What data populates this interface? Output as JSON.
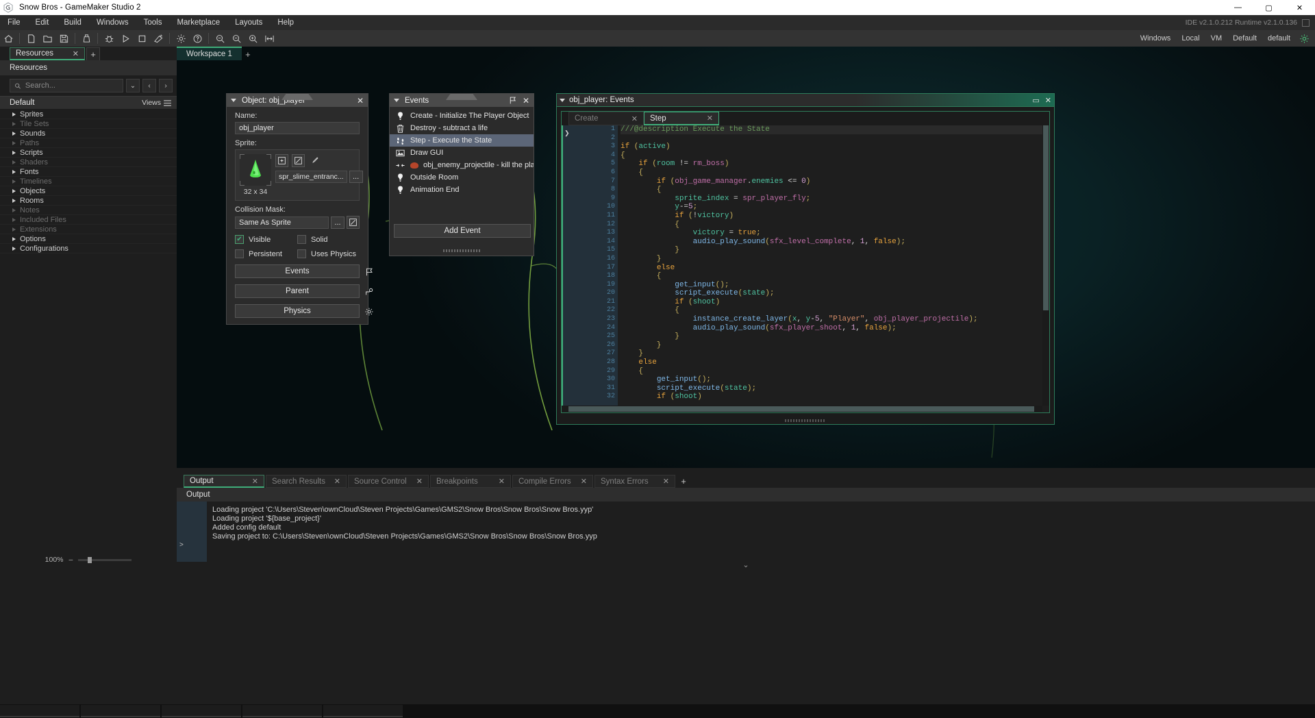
{
  "window": {
    "title": "Snow Bros - GameMaker Studio 2",
    "minimize": "—",
    "maximize": "▢",
    "close": "✕"
  },
  "menubar": {
    "items": [
      "File",
      "Edit",
      "Build",
      "Windows",
      "Tools",
      "Marketplace",
      "Layouts",
      "Help"
    ],
    "version_text": "IDE v2.1.0.212 Runtime v2.1.0.136"
  },
  "toolbar": {
    "right_items": [
      "Windows",
      "Local",
      "VM",
      "Default",
      "default"
    ]
  },
  "left_panel": {
    "tab_label": "Resources",
    "tab_close": "✕",
    "tab_add": "+",
    "header": "Resources",
    "search_placeholder": "Search...",
    "search_value": "",
    "default_label": "Default",
    "views_label": "Views",
    "tree": [
      {
        "label": "Sprites",
        "enabled": true
      },
      {
        "label": "Tile Sets",
        "enabled": false
      },
      {
        "label": "Sounds",
        "enabled": true
      },
      {
        "label": "Paths",
        "enabled": false
      },
      {
        "label": "Scripts",
        "enabled": true
      },
      {
        "label": "Shaders",
        "enabled": false
      },
      {
        "label": "Fonts",
        "enabled": true
      },
      {
        "label": "Timelines",
        "enabled": false
      },
      {
        "label": "Objects",
        "enabled": true
      },
      {
        "label": "Rooms",
        "enabled": true
      },
      {
        "label": "Notes",
        "enabled": false
      },
      {
        "label": "Included Files",
        "enabled": false
      },
      {
        "label": "Extensions",
        "enabled": false
      },
      {
        "label": "Options",
        "enabled": true
      },
      {
        "label": "Configurations",
        "enabled": true
      }
    ],
    "zoom_level": "100%"
  },
  "workspace": {
    "tab_label": "Workspace 1",
    "tab_add": "+"
  },
  "object_window": {
    "title": "Object: obj_player",
    "close": "✕",
    "name_label": "Name:",
    "name_value": "obj_player",
    "sprite_label": "Sprite:",
    "sprite_name": "spr_slime_entranc...",
    "sprite_dims": "32 x 34",
    "sprite_more": "...",
    "collision_label": "Collision Mask:",
    "collision_value": "Same As Sprite",
    "collision_more": "...",
    "checkboxes": [
      {
        "label": "Visible",
        "checked": true
      },
      {
        "label": "Solid",
        "checked": false
      },
      {
        "label": "Persistent",
        "checked": false
      },
      {
        "label": "Uses Physics",
        "checked": false
      }
    ],
    "buttons": [
      "Events",
      "Parent",
      "Physics"
    ]
  },
  "events_window": {
    "title": "Events",
    "close": "✕",
    "items": [
      {
        "label": "Create - Initialize The Player Object",
        "icon": "lightbulb-icon",
        "selected": false
      },
      {
        "label": "Destroy - subtract a life",
        "icon": "trash-icon",
        "selected": false
      },
      {
        "label": "Step - Execute the State",
        "icon": "footsteps-icon",
        "selected": true
      },
      {
        "label": "Draw GUI",
        "icon": "image-icon",
        "selected": false
      },
      {
        "label": "obj_enemy_projectile - kill the player",
        "icon": "collision-icon",
        "selected": false
      },
      {
        "label": "Outside Room",
        "icon": "lightbulb-icon",
        "selected": false
      },
      {
        "label": "Animation End",
        "icon": "lightbulb-icon",
        "selected": false
      }
    ],
    "add_event_label": "Add Event"
  },
  "code_window": {
    "title": "obj_player: Events",
    "minimize": "▭",
    "close": "✕",
    "tabs": [
      {
        "label": "Create",
        "active": false,
        "close": "✕"
      },
      {
        "label": "Step",
        "active": true,
        "close": "✕"
      }
    ],
    "lines": [
      {
        "n": 1,
        "tokens": [
          {
            "t": "///@description Execute the State",
            "c": "com"
          }
        ]
      },
      {
        "n": 2,
        "tokens": []
      },
      {
        "n": 3,
        "tokens": [
          {
            "t": "if",
            "c": "kw"
          },
          {
            "t": " (",
            "c": "brc"
          },
          {
            "t": "active",
            "c": "var"
          },
          {
            "t": ")",
            "c": "brc"
          }
        ]
      },
      {
        "n": 4,
        "tokens": [
          {
            "t": "{",
            "c": "brc"
          }
        ]
      },
      {
        "n": 5,
        "tokens": [
          {
            "t": "    ",
            "c": ""
          },
          {
            "t": "if",
            "c": "kw"
          },
          {
            "t": " (",
            "c": "brc"
          },
          {
            "t": "room",
            "c": "var"
          },
          {
            "t": " != ",
            "c": "op"
          },
          {
            "t": "rm_boss",
            "c": "res"
          },
          {
            "t": ")",
            "c": "brc"
          }
        ]
      },
      {
        "n": 6,
        "tokens": [
          {
            "t": "    {",
            "c": "brc"
          }
        ]
      },
      {
        "n": 7,
        "tokens": [
          {
            "t": "        ",
            "c": ""
          },
          {
            "t": "if",
            "c": "kw"
          },
          {
            "t": " (",
            "c": "brc"
          },
          {
            "t": "obj_game_manager",
            "c": "res"
          },
          {
            "t": ".",
            "c": "op"
          },
          {
            "t": "enemies",
            "c": "var"
          },
          {
            "t": " <= ",
            "c": "op"
          },
          {
            "t": "0",
            "c": "num"
          },
          {
            "t": ")",
            "c": "brc"
          }
        ]
      },
      {
        "n": 8,
        "tokens": [
          {
            "t": "        {",
            "c": "brc"
          }
        ]
      },
      {
        "n": 9,
        "tokens": [
          {
            "t": "            ",
            "c": ""
          },
          {
            "t": "sprite_index",
            "c": "var"
          },
          {
            "t": " = ",
            "c": "op"
          },
          {
            "t": "spr_player_fly",
            "c": "res"
          },
          {
            "t": ";",
            "c": "brc"
          }
        ]
      },
      {
        "n": 10,
        "tokens": [
          {
            "t": "            ",
            "c": ""
          },
          {
            "t": "y",
            "c": "var"
          },
          {
            "t": "-=",
            "c": "op"
          },
          {
            "t": "5",
            "c": "num"
          },
          {
            "t": ";",
            "c": "brc"
          }
        ]
      },
      {
        "n": 11,
        "tokens": [
          {
            "t": "            ",
            "c": ""
          },
          {
            "t": "if",
            "c": "kw"
          },
          {
            "t": " (",
            "c": "brc"
          },
          {
            "t": "!",
            "c": "op"
          },
          {
            "t": "victory",
            "c": "var"
          },
          {
            "t": ")",
            "c": "brc"
          }
        ]
      },
      {
        "n": 12,
        "tokens": [
          {
            "t": "            {",
            "c": "brc"
          }
        ]
      },
      {
        "n": 13,
        "tokens": [
          {
            "t": "                ",
            "c": ""
          },
          {
            "t": "victory",
            "c": "var"
          },
          {
            "t": " = ",
            "c": "op"
          },
          {
            "t": "true",
            "c": "kw"
          },
          {
            "t": ";",
            "c": "brc"
          }
        ]
      },
      {
        "n": 14,
        "tokens": [
          {
            "t": "                ",
            "c": ""
          },
          {
            "t": "audio_play_sound",
            "c": "fn"
          },
          {
            "t": "(",
            "c": "brc"
          },
          {
            "t": "sfx_level_complete",
            "c": "res"
          },
          {
            "t": ", ",
            "c": "op"
          },
          {
            "t": "1",
            "c": "num"
          },
          {
            "t": ", ",
            "c": "op"
          },
          {
            "t": "false",
            "c": "kw"
          },
          {
            "t": ");",
            "c": "brc"
          }
        ]
      },
      {
        "n": 15,
        "tokens": [
          {
            "t": "            }",
            "c": "brc"
          }
        ]
      },
      {
        "n": 16,
        "tokens": [
          {
            "t": "        }",
            "c": "brc"
          }
        ]
      },
      {
        "n": 17,
        "tokens": [
          {
            "t": "        ",
            "c": ""
          },
          {
            "t": "else",
            "c": "kw"
          }
        ]
      },
      {
        "n": 18,
        "tokens": [
          {
            "t": "        {",
            "c": "brc"
          }
        ]
      },
      {
        "n": 19,
        "tokens": [
          {
            "t": "            ",
            "c": ""
          },
          {
            "t": "get_input",
            "c": "fn"
          },
          {
            "t": "();",
            "c": "brc"
          }
        ]
      },
      {
        "n": 20,
        "tokens": [
          {
            "t": "            ",
            "c": ""
          },
          {
            "t": "script_execute",
            "c": "fn"
          },
          {
            "t": "(",
            "c": "brc"
          },
          {
            "t": "state",
            "c": "var"
          },
          {
            "t": ");",
            "c": "brc"
          }
        ]
      },
      {
        "n": 21,
        "tokens": [
          {
            "t": "            ",
            "c": ""
          },
          {
            "t": "if",
            "c": "kw"
          },
          {
            "t": " (",
            "c": "brc"
          },
          {
            "t": "shoot",
            "c": "var"
          },
          {
            "t": ")",
            "c": "brc"
          }
        ]
      },
      {
        "n": 22,
        "tokens": [
          {
            "t": "            {",
            "c": "brc"
          }
        ]
      },
      {
        "n": 23,
        "tokens": [
          {
            "t": "                ",
            "c": ""
          },
          {
            "t": "instance_create_layer",
            "c": "fn"
          },
          {
            "t": "(",
            "c": "brc"
          },
          {
            "t": "x",
            "c": "var"
          },
          {
            "t": ", ",
            "c": "op"
          },
          {
            "t": "y",
            "c": "var"
          },
          {
            "t": "-",
            "c": "op"
          },
          {
            "t": "5",
            "c": "num"
          },
          {
            "t": ", ",
            "c": "op"
          },
          {
            "t": "\"Player\"",
            "c": "str"
          },
          {
            "t": ", ",
            "c": "op"
          },
          {
            "t": "obj_player_projectile",
            "c": "res"
          },
          {
            "t": ");",
            "c": "brc"
          }
        ]
      },
      {
        "n": 24,
        "tokens": [
          {
            "t": "                ",
            "c": ""
          },
          {
            "t": "audio_play_sound",
            "c": "fn"
          },
          {
            "t": "(",
            "c": "brc"
          },
          {
            "t": "sfx_player_shoot",
            "c": "res"
          },
          {
            "t": ", ",
            "c": "op"
          },
          {
            "t": "1",
            "c": "num"
          },
          {
            "t": ", ",
            "c": "op"
          },
          {
            "t": "false",
            "c": "kw"
          },
          {
            "t": ");",
            "c": "brc"
          }
        ]
      },
      {
        "n": 25,
        "tokens": [
          {
            "t": "            }",
            "c": "brc"
          }
        ]
      },
      {
        "n": 26,
        "tokens": [
          {
            "t": "        }",
            "c": "brc"
          }
        ]
      },
      {
        "n": 27,
        "tokens": [
          {
            "t": "    }",
            "c": "brc"
          }
        ]
      },
      {
        "n": 28,
        "tokens": [
          {
            "t": "    ",
            "c": ""
          },
          {
            "t": "else",
            "c": "kw"
          }
        ]
      },
      {
        "n": 29,
        "tokens": [
          {
            "t": "    {",
            "c": "brc"
          }
        ]
      },
      {
        "n": 30,
        "tokens": [
          {
            "t": "        ",
            "c": ""
          },
          {
            "t": "get_input",
            "c": "fn"
          },
          {
            "t": "();",
            "c": "brc"
          }
        ]
      },
      {
        "n": 31,
        "tokens": [
          {
            "t": "        ",
            "c": ""
          },
          {
            "t": "script_execute",
            "c": "fn"
          },
          {
            "t": "(",
            "c": "brc"
          },
          {
            "t": "state",
            "c": "var"
          },
          {
            "t": ");",
            "c": "brc"
          }
        ]
      },
      {
        "n": 32,
        "tokens": [
          {
            "t": "        ",
            "c": ""
          },
          {
            "t": "if",
            "c": "kw"
          },
          {
            "t": " (",
            "c": "brc"
          },
          {
            "t": "shoot",
            "c": "var"
          },
          {
            "t": ")",
            "c": "brc"
          }
        ]
      }
    ]
  },
  "output_dock": {
    "tabs": [
      {
        "label": "Output",
        "active": true,
        "close": "✕"
      },
      {
        "label": "Search Results",
        "active": false,
        "close": "✕"
      },
      {
        "label": "Source Control",
        "active": false,
        "close": "✕"
      },
      {
        "label": "Breakpoints",
        "active": false,
        "close": "✕"
      },
      {
        "label": "Compile Errors",
        "active": false,
        "close": "✕"
      },
      {
        "label": "Syntax Errors",
        "active": false,
        "close": "✕"
      }
    ],
    "tab_add": "+",
    "subheader": "Output",
    "prompt": ">",
    "log": [
      "Loading project 'C:\\Users\\Steven\\ownCloud\\Steven Projects\\Games\\GMS2\\Snow Bros\\Snow Bros\\Snow Bros.yyp'",
      "Loading project '${base_project}'",
      "Added config default",
      "Saving project to: C:\\Users\\Steven\\ownCloud\\Steven Projects\\Games\\GMS2\\Snow Bros\\Snow Bros\\Snow Bros.yyp"
    ],
    "collapse_chevron": "⌄"
  },
  "taskbar": {
    "clock": ""
  },
  "colors": {
    "accent_green": "#3fae7a",
    "titlebar_bg": "#ffffff",
    "menubar_bg": "#2b2b2b",
    "panel_bg": "#2b2b2b",
    "editor_bg": "#1e1e1e",
    "selection": "#5c6678"
  }
}
